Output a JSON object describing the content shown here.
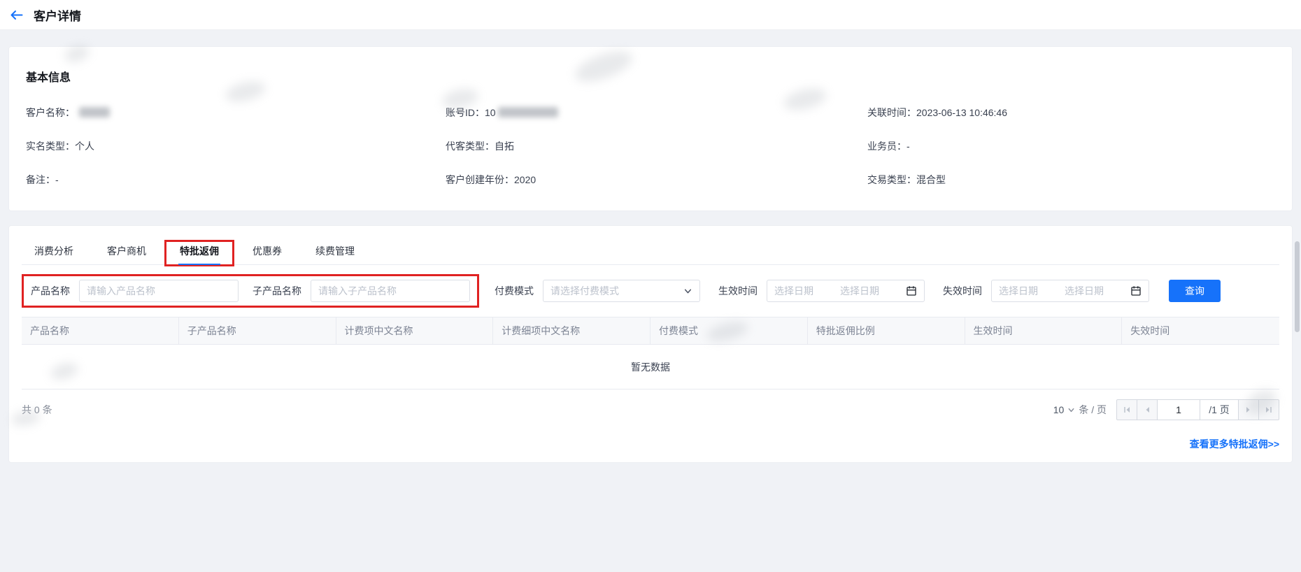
{
  "colors": {
    "accent": "#1672fa",
    "annotation": "#e02222"
  },
  "header": {
    "title": "客户详情"
  },
  "basic_info": {
    "title": "基本信息",
    "fields": [
      {
        "label": "客户名称：",
        "value": "",
        "redacted": true
      },
      {
        "label": "账号ID：",
        "value": "10",
        "redacted": true
      },
      {
        "label": "关联时间：",
        "value": "2023-06-13 10:46:46"
      },
      {
        "label": "实名类型：",
        "value": "个人"
      },
      {
        "label": "代客类型：",
        "value": "自拓"
      },
      {
        "label": "业务员：",
        "value": "-"
      },
      {
        "label": "备注：",
        "value": "-"
      },
      {
        "label": "客户创建年份：",
        "value": "2020"
      },
      {
        "label": "交易类型：",
        "value": "混合型"
      }
    ]
  },
  "tabs": [
    {
      "label": "消费分析"
    },
    {
      "label": "客户商机"
    },
    {
      "label": "特批返佣",
      "active": true
    },
    {
      "label": "优惠券"
    },
    {
      "label": "续费管理"
    }
  ],
  "filters": {
    "product_name": {
      "label": "产品名称",
      "placeholder": "请输入产品名称",
      "value": ""
    },
    "sub_product_name": {
      "label": "子产品名称",
      "placeholder": "请输入子产品名称",
      "value": ""
    },
    "pay_mode": {
      "label": "付费模式",
      "placeholder": "请选择付费模式"
    },
    "effective_time": {
      "label": "生效时间",
      "start_placeholder": "选择日期",
      "end_placeholder": "选择日期"
    },
    "expire_time": {
      "label": "失效时间",
      "start_placeholder": "选择日期",
      "end_placeholder": "选择日期"
    },
    "search_button": "查询"
  },
  "table": {
    "columns": [
      "产品名称",
      "子产品名称",
      "计费项中文名称",
      "计费细项中文名称",
      "付费模式",
      "特批返佣比例",
      "生效时间",
      "失效时间"
    ],
    "empty_text": "暂无数据",
    "rows": []
  },
  "pagination": {
    "total_text": "共 0 条",
    "page_size": "10",
    "unit_text": "条 / 页",
    "current_page": "1",
    "page_count_text": "/1 页"
  },
  "footer_link": "查看更多特批返佣>>"
}
